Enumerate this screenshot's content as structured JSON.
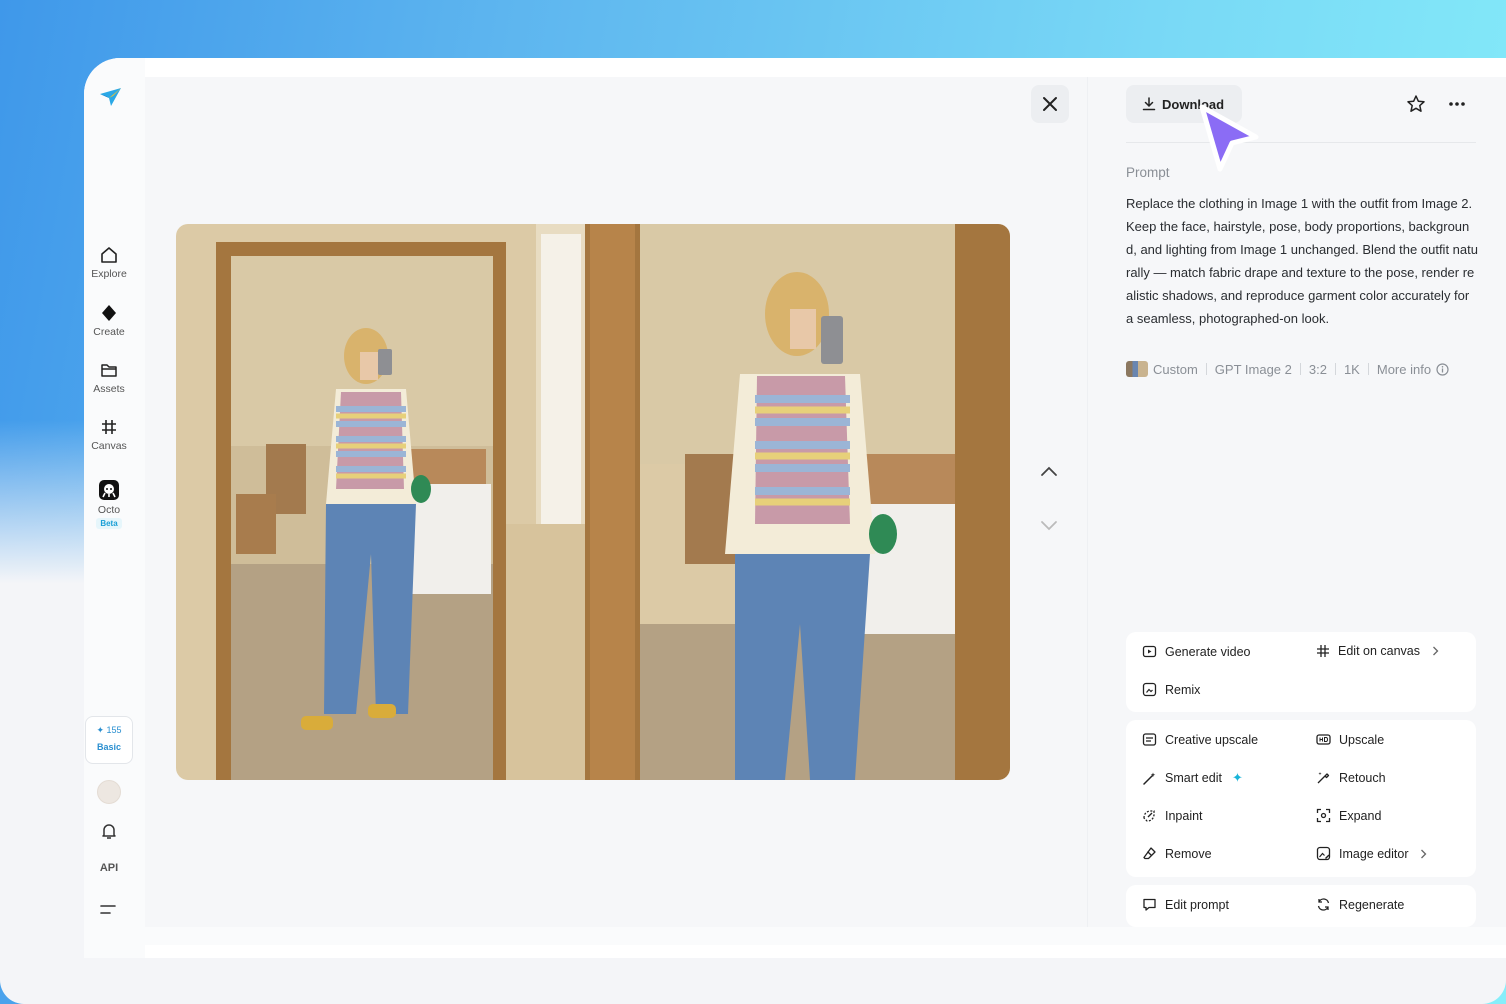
{
  "sidebar": {
    "items": [
      {
        "label": "Explore",
        "icon": "home-icon"
      },
      {
        "label": "Create",
        "icon": "diamond-icon"
      },
      {
        "label": "Assets",
        "icon": "folder-icon"
      },
      {
        "label": "Canvas",
        "icon": "canvas-grid-icon"
      },
      {
        "label": "Octo",
        "icon": "octo-icon",
        "badge": "Beta"
      }
    ],
    "credits": {
      "amount": "✦ 155",
      "tier": "Basic"
    },
    "api_label": "API"
  },
  "header": {
    "download_label": "Download"
  },
  "prompt": {
    "label": "Prompt",
    "text": "Replace the clothing in Image 1 with the outfit from Image 2. Keep the face, hairstyle, pose, body proportions, background, and lighting from Image 1 unchanged. Blend the outfit naturally — match fabric drape and texture to the pose, render realistic shadows, and reproduce garment color accurately for a seamless, photographed-on look."
  },
  "meta": {
    "style": "Custom",
    "model": "GPT Image 2",
    "ratio": "3:2",
    "resolution": "1K",
    "more_info": "More info"
  },
  "actions": {
    "group1": {
      "generate_video": "Generate video",
      "edit_on_canvas": "Edit on canvas",
      "remix": "Remix"
    },
    "group2": {
      "creative_upscale": "Creative upscale",
      "upscale": "Upscale",
      "smart_edit": "Smart edit",
      "retouch": "Retouch",
      "inpaint": "Inpaint",
      "expand": "Expand",
      "remove": "Remove",
      "image_editor": "Image editor"
    },
    "group3": {
      "edit_prompt": "Edit prompt",
      "regenerate": "Regenerate"
    }
  },
  "colors": {
    "accent_blue": "#1a9fd6",
    "cursor_purple": "#8b6cf5",
    "panel_bg": "#f6f7f9"
  }
}
